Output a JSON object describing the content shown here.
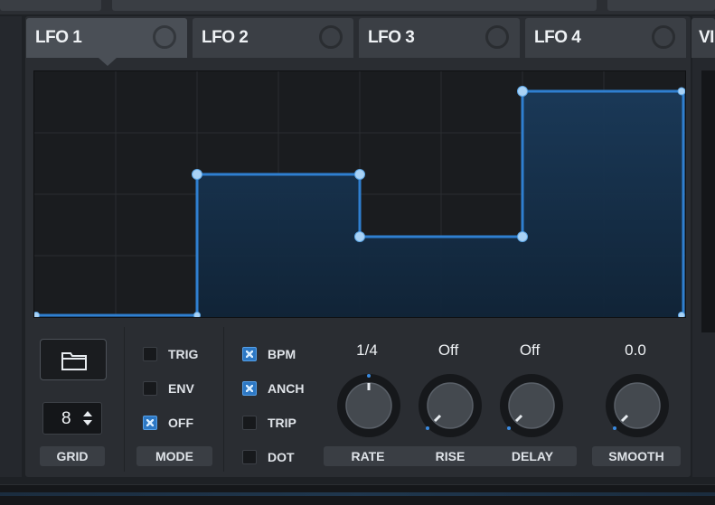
{
  "tabs": [
    {
      "label": "LFO 1",
      "active": true
    },
    {
      "label": "LFO 2",
      "active": false
    },
    {
      "label": "LFO 3",
      "active": false
    },
    {
      "label": "LFO 4",
      "active": false
    },
    {
      "label": "VI",
      "active": false
    }
  ],
  "grid": {
    "value": "8",
    "label": "GRID"
  },
  "mode": {
    "label": "MODE",
    "options": [
      {
        "label": "TRIG",
        "checked": false
      },
      {
        "label": "ENV",
        "checked": false
      },
      {
        "label": "OFF",
        "checked": true
      }
    ]
  },
  "sync": [
    {
      "label": "BPM",
      "checked": true
    },
    {
      "label": "ANCH",
      "checked": true
    },
    {
      "label": "TRIP",
      "checked": false
    },
    {
      "label": "DOT",
      "checked": false
    }
  ],
  "knobs": [
    {
      "label": "RATE",
      "value": "1/4"
    },
    {
      "label": "RISE",
      "value": "Off"
    },
    {
      "label": "DELAY",
      "value": "Off"
    },
    {
      "label": "SMOOTH",
      "value": "0.0"
    }
  ],
  "colors": {
    "accent": "#2f7fd0",
    "point": "#a9d2f5",
    "fill": "#17324d"
  },
  "icons": {
    "browse": "folder-icon",
    "grid_stepper": "up-down-arrows-icon"
  }
}
